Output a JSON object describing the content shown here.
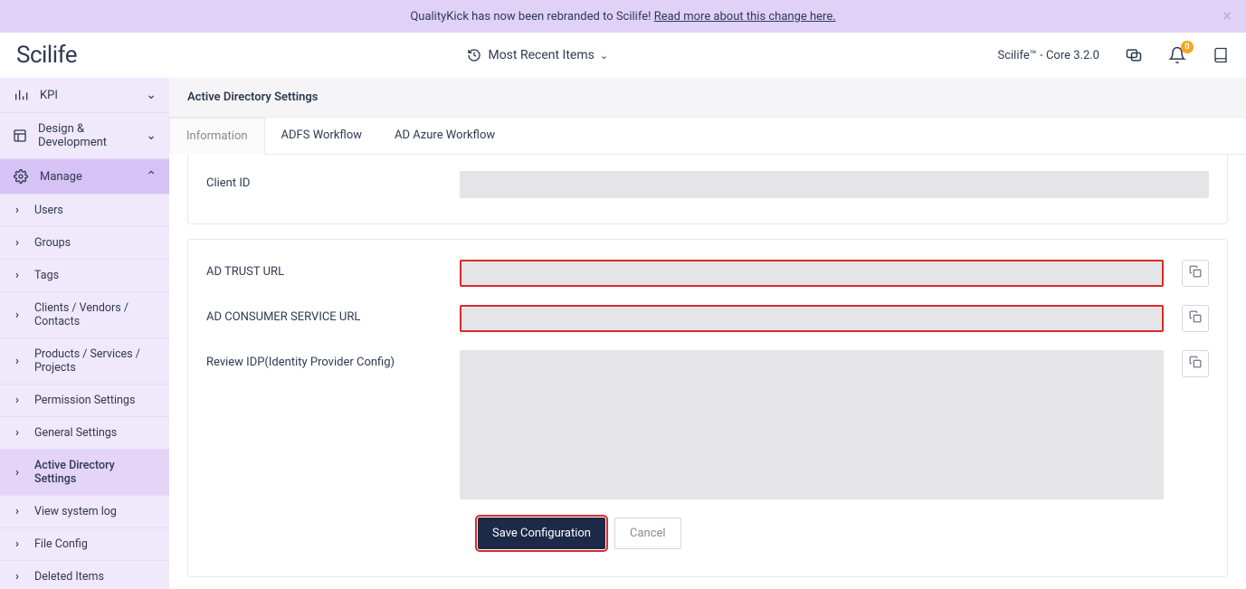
{
  "banner": {
    "text_prefix": "QualityKick has now been rebranded to Scilife! ",
    "link_text": "Read more about this change here."
  },
  "header": {
    "logo": "Scilife",
    "recent_label": "Most Recent Items",
    "version": "Scilife™ - Core 3.2.0",
    "notif_badge": "0"
  },
  "sidebar": {
    "top": [
      {
        "label": "KPI"
      },
      {
        "label": "Design & Development"
      }
    ],
    "manage_label": "Manage",
    "manage_items": [
      {
        "label": "Users"
      },
      {
        "label": "Groups"
      },
      {
        "label": "Tags"
      },
      {
        "label": "Clients / Vendors / Contacts"
      },
      {
        "label": "Products / Services / Projects"
      },
      {
        "label": "Permission Settings"
      },
      {
        "label": "General Settings"
      },
      {
        "label": "Active Directory Settings"
      },
      {
        "label": "View system log"
      },
      {
        "label": "File Config"
      },
      {
        "label": "Deleted Items"
      }
    ]
  },
  "page": {
    "title": "Active Directory Settings",
    "tabs": {
      "info": "Information",
      "adfs": "ADFS Workflow",
      "azure": "AD Azure Workflow"
    },
    "form": {
      "client_id_label": "Client ID",
      "trust_url_label": "AD TRUST URL",
      "consumer_url_label": "AD CONSUMER SERVICE URL",
      "idp_label": "Review IDP(Identity Provider Config)",
      "save_label": "Save Configuration",
      "cancel_label": "Cancel"
    }
  }
}
